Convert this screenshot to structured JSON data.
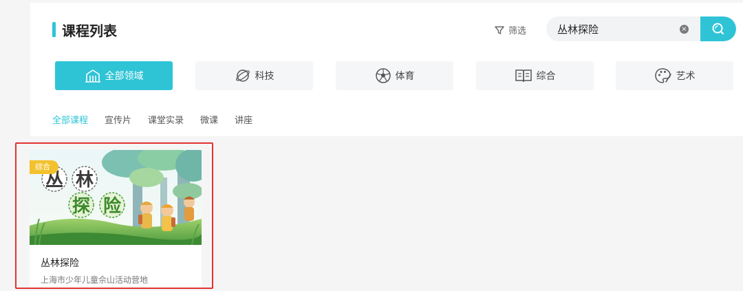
{
  "header": {
    "title": "课程列表",
    "filter_label": "筛选",
    "search": {
      "value": "丛林探险",
      "placeholder": ""
    }
  },
  "categories": [
    {
      "label": "全部领域",
      "icon": "building-icon",
      "active": true
    },
    {
      "label": "科技",
      "icon": "planet-icon",
      "active": false
    },
    {
      "label": "体育",
      "icon": "soccer-ball-icon",
      "active": false
    },
    {
      "label": "综合",
      "icon": "book-icon",
      "active": false
    },
    {
      "label": "艺术",
      "icon": "palette-icon",
      "active": false
    }
  ],
  "tabs": [
    {
      "label": "全部课程",
      "active": true
    },
    {
      "label": "宣传片",
      "active": false
    },
    {
      "label": "课堂实录",
      "active": false
    },
    {
      "label": "微课",
      "active": false
    },
    {
      "label": "讲座",
      "active": false
    }
  ],
  "course_card": {
    "badge": "综合",
    "title": "丛林探险",
    "subtitle": "上海市少年儿童佘山活动营地",
    "thumbnail_text": [
      "丛",
      "林",
      "探",
      "险"
    ]
  },
  "colors": {
    "accent": "#2ec4d6",
    "badge": "#f2c12e",
    "highlight_outline": "#e0322d"
  }
}
